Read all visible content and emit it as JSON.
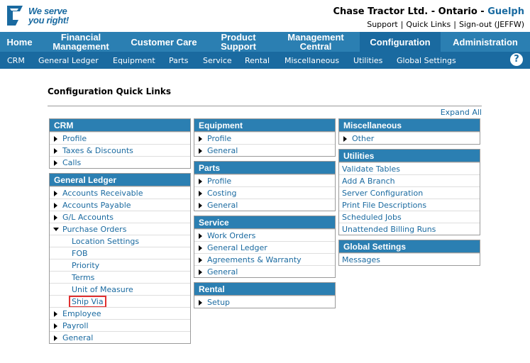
{
  "header": {
    "logo_line1": "We serve",
    "logo_line2": "you right!",
    "company": "Chase Tractor Ltd. - Ontario - ",
    "branch": "Guelph",
    "links": [
      "Support",
      "Quick Links",
      "Sign-out (JEFFW)"
    ]
  },
  "main_nav": [
    {
      "label": "Home",
      "active": false
    },
    {
      "label": "Financial Management",
      "active": false
    },
    {
      "label": "Customer Care",
      "active": false
    },
    {
      "label": "Product Support",
      "active": false
    },
    {
      "label": "Management Central",
      "active": false
    },
    {
      "label": "Configuration",
      "active": true
    },
    {
      "label": "Administration",
      "active": false
    }
  ],
  "sub_nav": [
    "CRM",
    "General Ledger",
    "Equipment",
    "Parts",
    "Service",
    "Rental",
    "Miscellaneous",
    "Utilities",
    "Global Settings"
  ],
  "help_icon": "?",
  "page_title": "Configuration Quick Links",
  "expand_all": "Expand All",
  "panels": {
    "crm": {
      "title": "CRM",
      "items": [
        "Profile",
        "Taxes & Discounts",
        "Calls"
      ]
    },
    "general_ledger": {
      "title": "General Ledger",
      "items": [
        "Accounts Receivable",
        "Accounts Payable",
        "G/L Accounts",
        "Purchase Orders"
      ],
      "purchase_orders_children": [
        "Location Settings",
        "FOB",
        "Priority",
        "Terms",
        "Unit of Measure",
        "Ship Via"
      ],
      "items_after": [
        "Employee",
        "Payroll",
        "General"
      ]
    },
    "equipment": {
      "title": "Equipment",
      "items": [
        "Profile",
        "General"
      ]
    },
    "parts": {
      "title": "Parts",
      "items": [
        "Profile",
        "Costing",
        "General"
      ]
    },
    "service": {
      "title": "Service",
      "items": [
        "Work Orders",
        "General Ledger",
        "Agreements & Warranty",
        "General"
      ]
    },
    "rental": {
      "title": "Rental",
      "items": [
        "Setup"
      ]
    },
    "miscellaneous": {
      "title": "Miscellaneous",
      "items": [
        "Other"
      ]
    },
    "utilities": {
      "title": "Utilities",
      "items": [
        "Validate Tables",
        "Add A Branch",
        "Server Configuration",
        "Print File Descriptions",
        "Scheduled Jobs",
        "Unattended Billing Runs"
      ]
    },
    "global_settings": {
      "title": "Global Settings",
      "items": [
        "Messages"
      ]
    }
  },
  "colors": {
    "nav_blue": "#2b7fb2",
    "subnav_blue": "#1a6aa0",
    "link_blue": "#1a6aa0",
    "highlight_red": "#e03030"
  }
}
